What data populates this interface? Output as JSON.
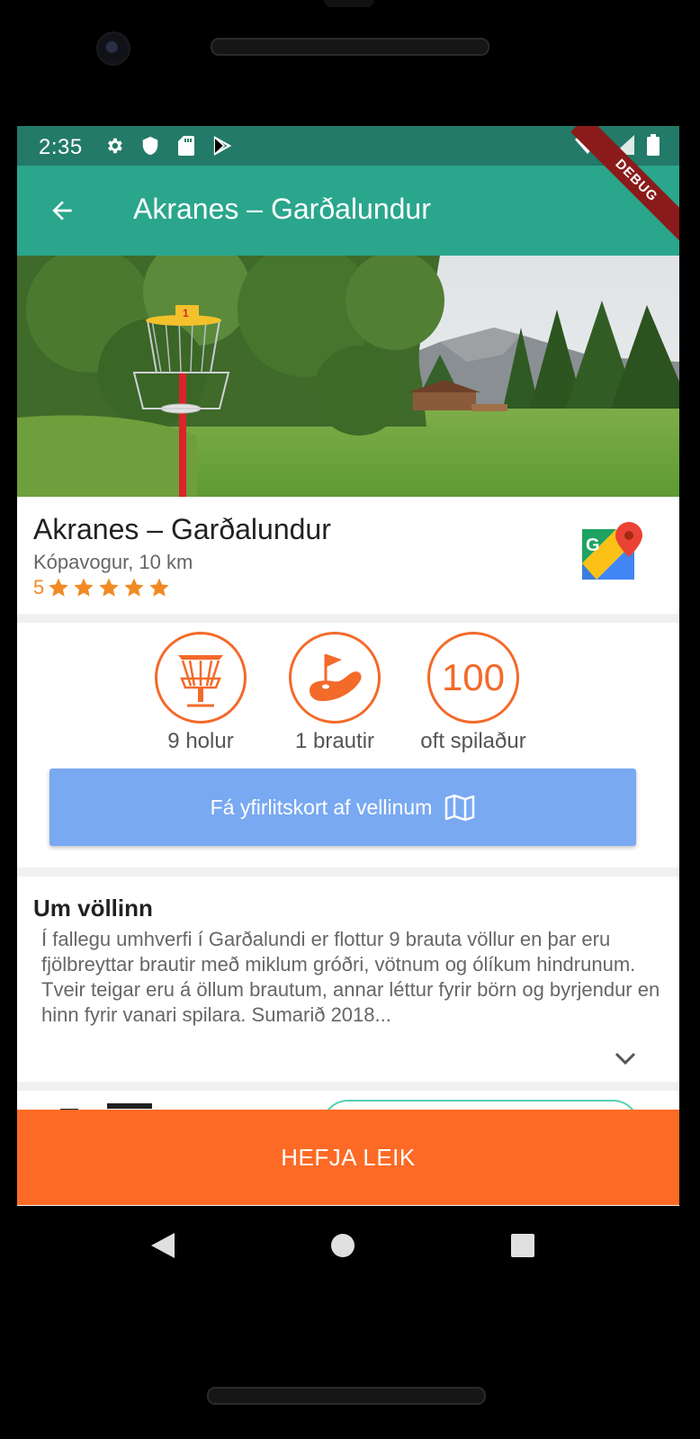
{
  "status_bar": {
    "time": "2:35",
    "icons": [
      "gear-icon",
      "shield-icon",
      "sd-card-icon",
      "play-store-icon"
    ],
    "right_icons": [
      "wifi-icon",
      "signal-icon",
      "battery-icon"
    ]
  },
  "app_bar": {
    "title": "Akranes – Garðalundur",
    "debug_label": "DEBUG"
  },
  "course": {
    "name": "Akranes – Garðalundur",
    "location": "Kópavogur, 10 km",
    "rating": "5",
    "stars": 5
  },
  "stats": [
    {
      "value": "",
      "label": "9 holur",
      "icon": "basket-icon"
    },
    {
      "value": "",
      "label": "1 brautir",
      "icon": "flag-icon"
    },
    {
      "value": "100",
      "label": "oft spilaður",
      "icon": ""
    }
  ],
  "map_button": {
    "label": "Fá yfirlitskort af vellinum",
    "icon": "map-icon"
  },
  "about": {
    "title": "Um völlinn",
    "text": "Í fallegu umhverfi í Garðalundi er flottur 9 brauta völlur en þar eru fjölbreyttar brautir með miklum gróðri, vötnum og ólíkum hindrunum. Tveir teigar eru á öllum brautum, annar léttur fyrir börn og byrjendur en hinn fyrir vanari spilara. Sumarið 2018..."
  },
  "start_button": {
    "label": "HEFJA LEIK"
  },
  "colors": {
    "status_bar": "#237a68",
    "app_bar": "#2aa68d",
    "accent_orange": "#f36a2a",
    "start_button": "#fd6a25",
    "map_button": "#79a9f1",
    "star": "#f28a24"
  }
}
